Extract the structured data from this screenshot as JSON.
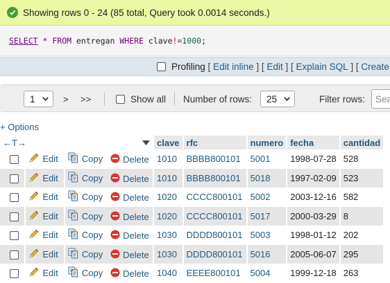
{
  "message": {
    "text": "Showing rows 0 - 24 (85 total, Query took 0.0014 seconds.)"
  },
  "sql": {
    "select": "SELECT",
    "star": "*",
    "from": "FROM",
    "table": "entregan",
    "where": "WHERE",
    "column": "clave",
    "operator": "!=",
    "value": "1000",
    "end": ";"
  },
  "profiling": {
    "label": "Profiling",
    "edit_inline": "Edit inline",
    "edit": "Edit",
    "explain_sql": "Explain SQL",
    "create": "Create P",
    "open_bracket": "[",
    "close_bracket": "]"
  },
  "navigation": {
    "page_value": "1",
    "next": ">",
    "last": ">>",
    "show_all": "Show all",
    "rows_label": "Number of rows:",
    "rows_value": "25",
    "filter_label": "Filter rows:",
    "filter_placeholder": "Sea"
  },
  "options_link": "+ Options",
  "table": {
    "sort_arrows": "←T→",
    "columns": [
      "clave",
      "rfc",
      "numero",
      "fecha",
      "cantidad"
    ],
    "actions": {
      "edit": "Edit",
      "copy": "Copy",
      "delete": "Delete"
    },
    "rows": [
      [
        "1010",
        "BBBB800101",
        "5001",
        "1998-07-28",
        "528"
      ],
      [
        "1010",
        "BBBB800101",
        "5018",
        "1997-02-09",
        "523"
      ],
      [
        "1020",
        "CCCC800101",
        "5002",
        "2003-12-16",
        "582"
      ],
      [
        "1020",
        "CCCC800101",
        "5017",
        "2000-03-29",
        "8"
      ],
      [
        "1030",
        "DDDD800101",
        "5003",
        "1998-01-12",
        "202"
      ],
      [
        "1030",
        "DDDD800101",
        "5016",
        "2005-06-07",
        "295"
      ],
      [
        "1040",
        "EEEE800101",
        "5004",
        "1999-12-18",
        "263"
      ]
    ]
  },
  "colors": {
    "success_bg": "#ebf8a4",
    "link": "#235a81",
    "sql_keyword": "#770088",
    "sql_number": "#116644",
    "delete_icon": "#d9362b"
  }
}
